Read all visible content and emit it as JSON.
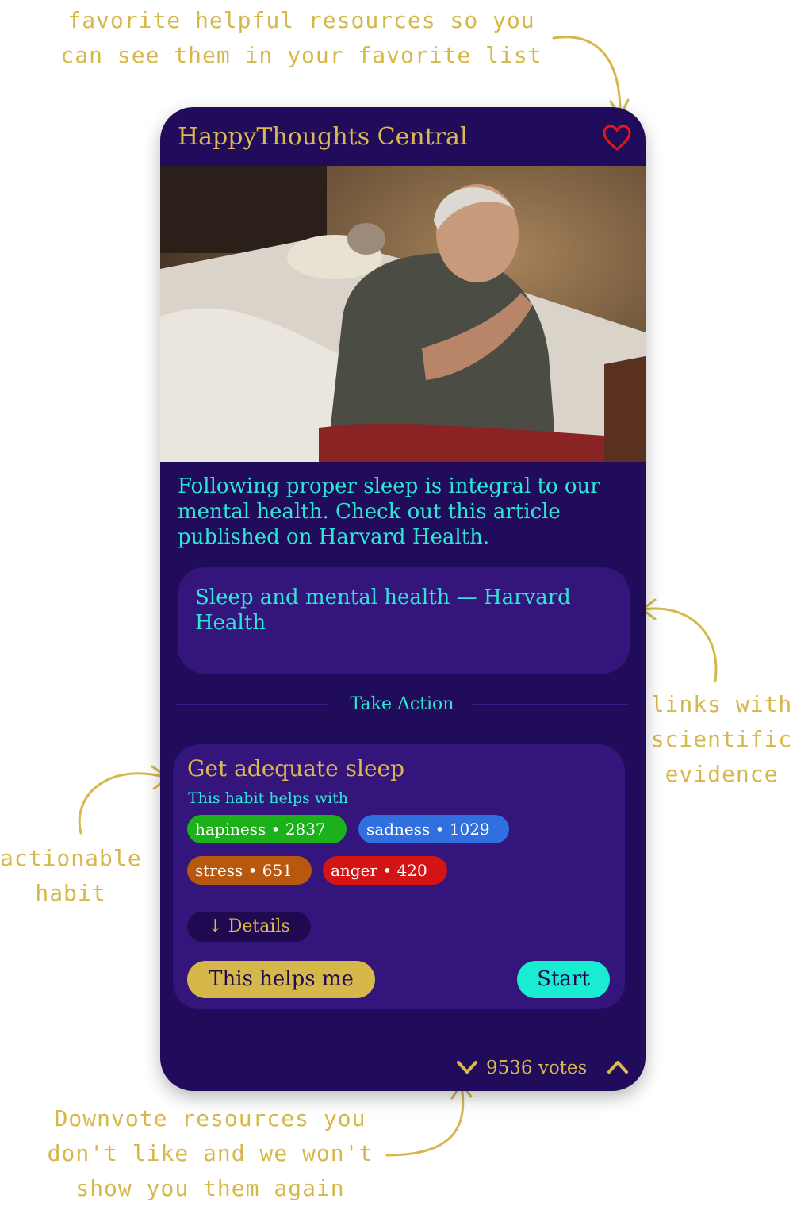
{
  "colors": {
    "phone_bg": "#200c5a",
    "card_bg": "#33157c",
    "gold": "#dcb84e",
    "cyan": "#2ee6d6",
    "heart": "#e01818"
  },
  "annotations": {
    "favorite": [
      "favorite helpful resources so you",
      "can see them in your favorite list"
    ],
    "links": [
      "links with",
      "scientific",
      "evidence"
    ],
    "habit": [
      "actionable",
      "habit"
    ],
    "downvote": [
      "Downvote resources you",
      "don't like and we won't",
      "show you them again"
    ]
  },
  "app": {
    "title": "HappyThoughts Central",
    "favorite_icon": "heart-outline-icon"
  },
  "resource": {
    "image": "photo of an older man sitting awake on the edge of a bed at night",
    "description": "Following proper sleep is integral to our mental health. Check out this article published on Harvard Health.",
    "link_text": "Sleep and mental health — Harvard Health"
  },
  "section_label": "Take Action",
  "habit": {
    "title": "Get adequate sleep",
    "helps_label": "This habit helps with",
    "tags": [
      {
        "label": "hapiness • 2837",
        "color": "#1cb01a"
      },
      {
        "label": "sadness • 1029",
        "color": "#2f6fe0"
      },
      {
        "label": "stress • 651",
        "color": "#b8570e"
      },
      {
        "label": "anger • 420",
        "color": "#d41414"
      }
    ],
    "details_label": "↓ Details",
    "helps_button": "This helps me",
    "start_button": "Start"
  },
  "votes": {
    "label": "9536 votes",
    "down_icon": "chevron-down-icon",
    "up_icon": "chevron-up-icon"
  }
}
